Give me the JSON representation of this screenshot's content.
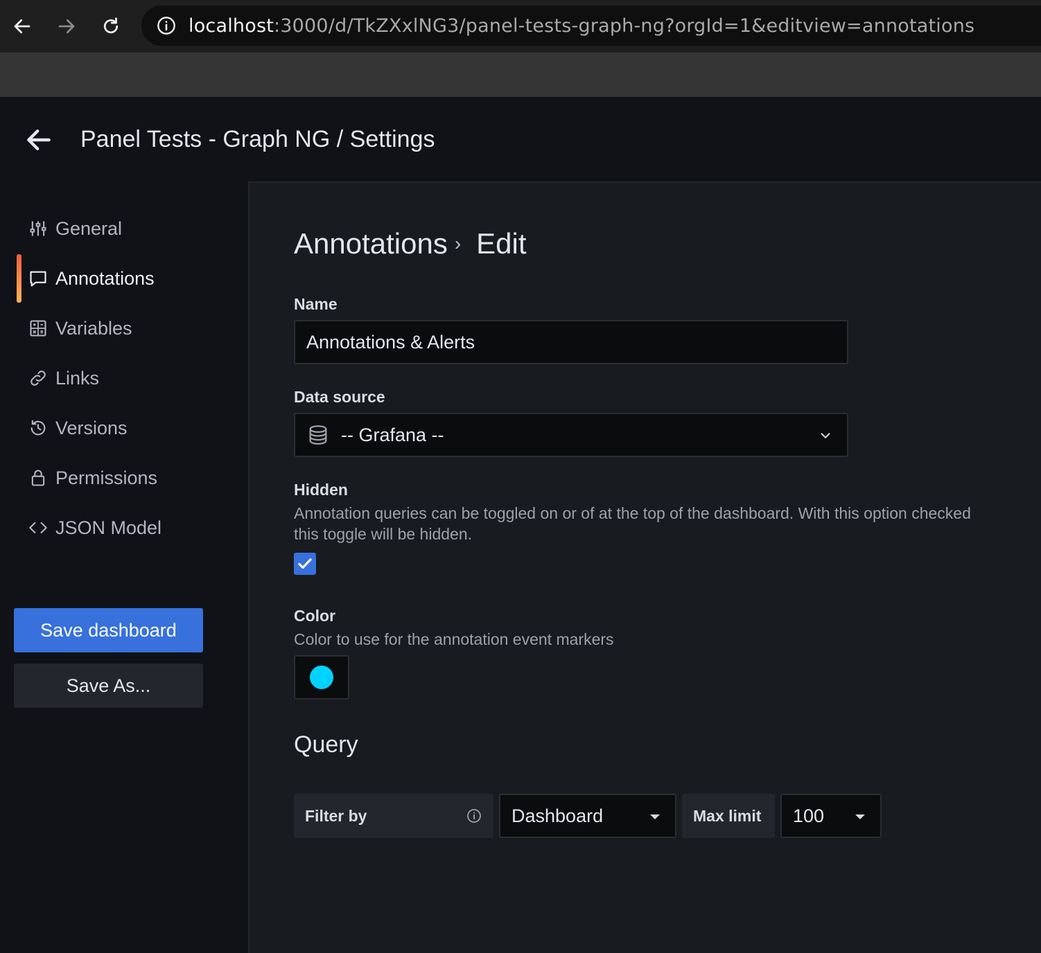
{
  "browser": {
    "url_host": "localhost",
    "url_rest": ":3000/d/TkZXxlNG3/panel-tests-graph-ng?orgId=1&editview=annotations"
  },
  "header": {
    "title": "Panel Tests - Graph NG / Settings"
  },
  "sidebar": {
    "items": [
      {
        "label": "General",
        "icon": "sliders-icon"
      },
      {
        "label": "Annotations",
        "icon": "comment-icon",
        "active": true
      },
      {
        "label": "Variables",
        "icon": "calculator-icon"
      },
      {
        "label": "Links",
        "icon": "link-icon"
      },
      {
        "label": "Versions",
        "icon": "history-icon"
      },
      {
        "label": "Permissions",
        "icon": "lock-icon"
      },
      {
        "label": "JSON Model",
        "icon": "code-brackets-icon"
      }
    ],
    "save_label": "Save dashboard",
    "save_as_label": "Save As..."
  },
  "main": {
    "breadcrumb": {
      "parent": "Annotations",
      "current": "Edit"
    },
    "name": {
      "label": "Name",
      "value": "Annotations & Alerts"
    },
    "datasource": {
      "label": "Data source",
      "value": "-- Grafana --"
    },
    "hidden": {
      "label": "Hidden",
      "description": "Annotation queries can be toggled on or of at the top of the dashboard. With this option checked this toggle will be hidden.",
      "checked": true
    },
    "color": {
      "label": "Color",
      "description": "Color to use for the annotation event markers",
      "value": "#00d3ff"
    },
    "query": {
      "title": "Query",
      "filter_by_label": "Filter by",
      "filter_by_value": "Dashboard",
      "max_limit_label": "Max limit",
      "max_limit_value": "100"
    }
  },
  "colors": {
    "accent": "#3871dc",
    "active_gradient_start": "#f55f3e",
    "active_gradient_end": "#ffb357"
  }
}
